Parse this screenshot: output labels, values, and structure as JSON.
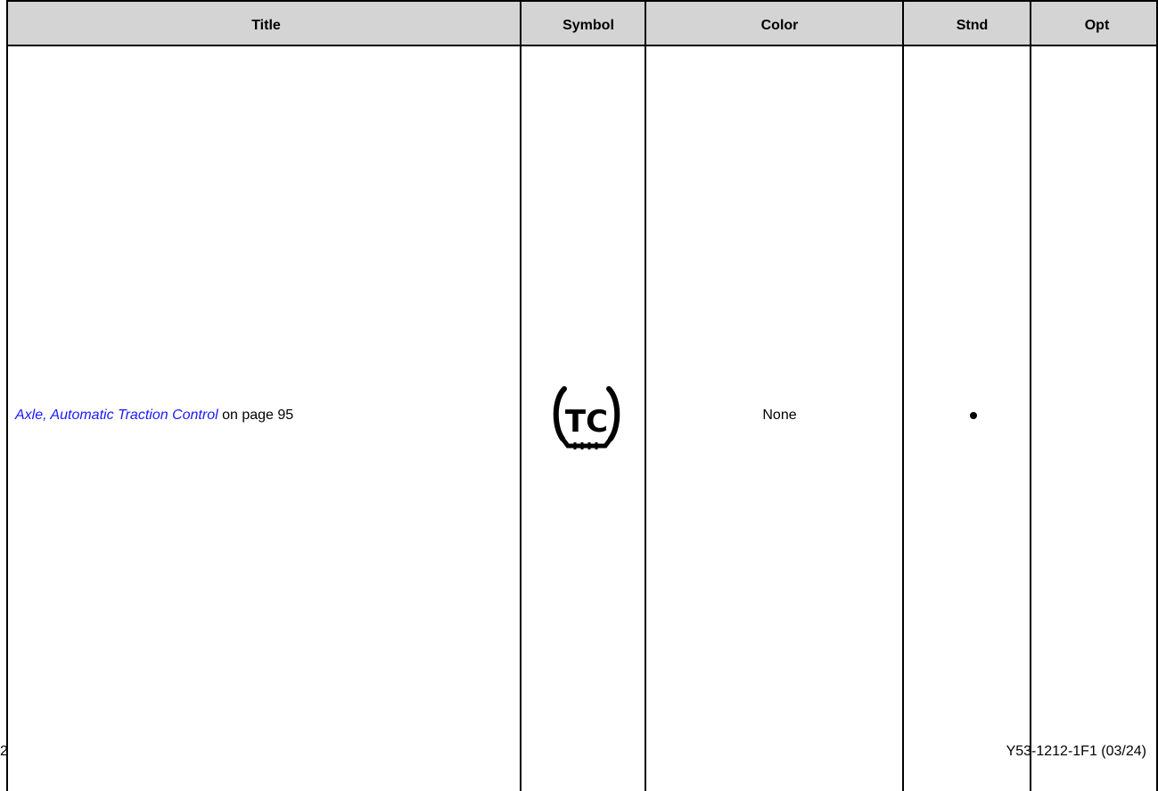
{
  "table": {
    "headers": [
      "Title",
      "Symbol",
      "Color",
      "Stnd",
      "Opt"
    ],
    "row": {
      "title_link": "Axle, Automatic Traction Control",
      "title_suffix": " on page 95",
      "symbol_icon": "traction-control-icon",
      "symbol_text": "TC",
      "color": "None",
      "stnd": "•",
      "opt": ""
    }
  },
  "footer": {
    "page_number_fragment": "2",
    "doc_id": "Y53-1212-1F1 (03/24)"
  }
}
